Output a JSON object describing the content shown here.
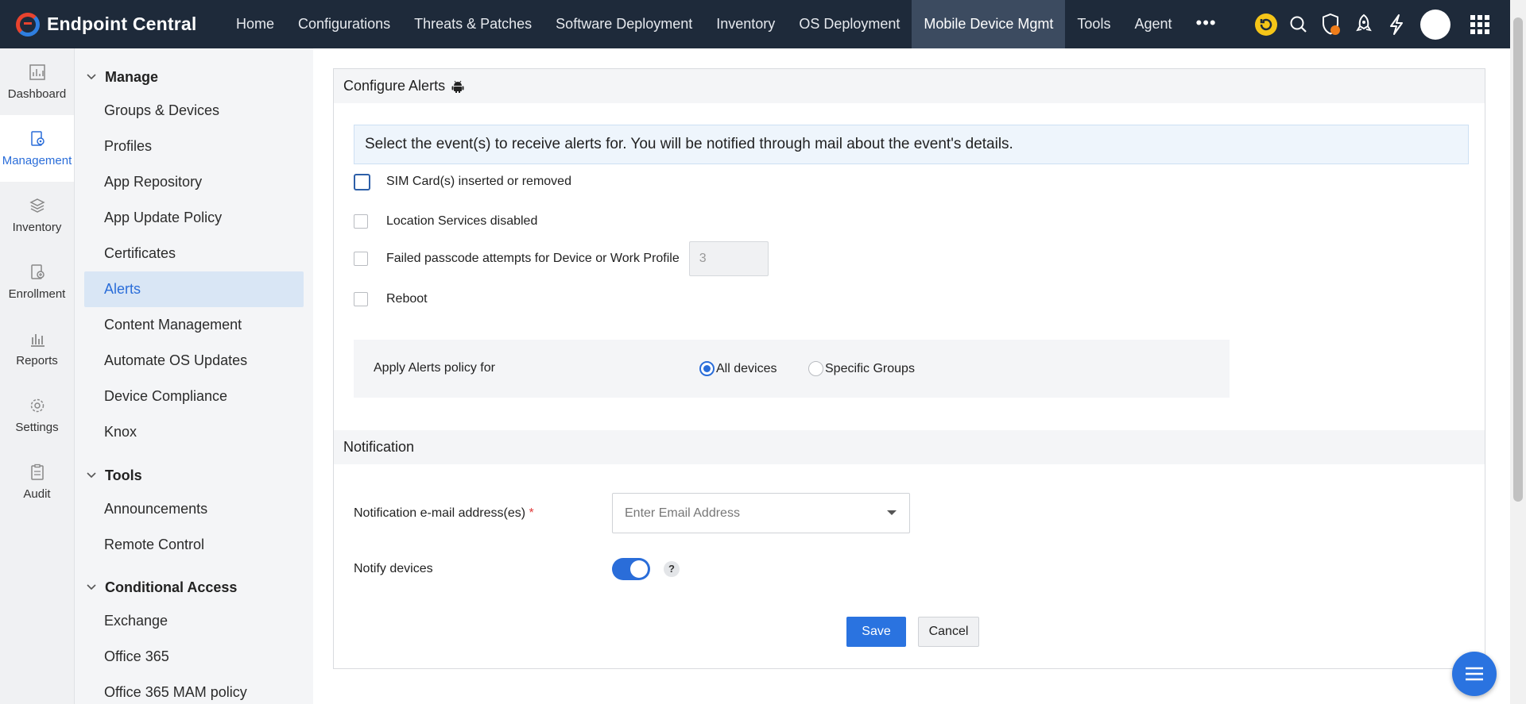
{
  "app": {
    "brand": "Endpoint Central"
  },
  "nav": {
    "items": [
      "Home",
      "Configurations",
      "Threats & Patches",
      "Software Deployment",
      "Inventory",
      "OS Deployment",
      "Mobile Device Mgmt",
      "Tools",
      "Agent"
    ],
    "active": "Mobile Device Mgmt",
    "more_icon": "ellipsis-icon"
  },
  "top_icons": [
    "refresh-badge-icon",
    "search-icon",
    "shield-alert-icon",
    "rocket-icon",
    "lightning-icon",
    "avatar",
    "app-grid-icon"
  ],
  "rail": {
    "items": [
      {
        "label": "Dashboard",
        "icon": "dashboard-icon"
      },
      {
        "label": "Management",
        "icon": "management-icon",
        "active": true
      },
      {
        "label": "Inventory",
        "icon": "layers-icon"
      },
      {
        "label": "Enrollment",
        "icon": "enrollment-icon"
      },
      {
        "label": "Reports",
        "icon": "reports-icon"
      },
      {
        "label": "Settings",
        "icon": "gear-icon"
      },
      {
        "label": "Audit",
        "icon": "clipboard-icon"
      }
    ]
  },
  "subnav": {
    "manage": {
      "title": "Manage",
      "items": [
        "Groups & Devices",
        "Profiles",
        "App Repository",
        "App Update Policy",
        "Certificates",
        "Alerts",
        "Content Management",
        "Automate OS Updates",
        "Device Compliance",
        "Knox"
      ],
      "active": "Alerts"
    },
    "tools": {
      "title": "Tools",
      "items": [
        "Announcements",
        "Remote Control"
      ]
    },
    "conditional": {
      "title": "Conditional Access",
      "items": [
        "Exchange",
        "Office 365",
        "Office 365 MAM policy"
      ]
    }
  },
  "panel": {
    "title": "Configure Alerts",
    "title_icon": "android-icon",
    "info": "Select the event(s) to receive alerts for. You will be notified through mail about the event's details.",
    "events": [
      {
        "label": "SIM Card(s) inserted or removed",
        "checked": false
      },
      {
        "label": "Location Services disabled",
        "checked": false
      },
      {
        "label": "Failed passcode attempts for Device or Work Profile",
        "checked": false,
        "value": "3"
      },
      {
        "label": "Reboot",
        "checked": false
      }
    ],
    "policy": {
      "label": "Apply Alerts policy for",
      "options": [
        "All devices",
        "Specific Groups"
      ],
      "selected": "All devices"
    }
  },
  "notification": {
    "title": "Notification",
    "email_label": "Notification e-mail address(es)",
    "required_mark": "*",
    "email_placeholder": "Enter Email Address",
    "notify_label": "Notify devices",
    "notify_on": true,
    "help": "?"
  },
  "actions": {
    "save": "Save",
    "cancel": "Cancel"
  },
  "colors": {
    "accent": "#2a73e0",
    "topbar": "#1e2a3a",
    "active_nav": "#3c4b60",
    "required": "#e03a3a"
  }
}
